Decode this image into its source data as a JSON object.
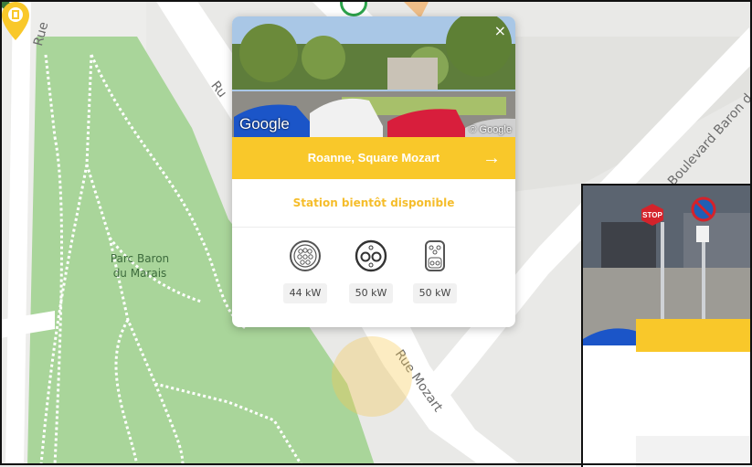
{
  "map": {
    "roads": {
      "rue_left": "Rue",
      "rue_center_top": "Ru",
      "boulevard": "Boulevard Baron d",
      "rue_mozart": "Rue Mozart"
    },
    "park": {
      "line1": "Parc Baron",
      "line2": "du Marais"
    },
    "colors": {
      "park": "#a9d59a",
      "road": "#ffffff",
      "background": "#e9e9e7",
      "path": "#ffffff"
    }
  },
  "popup": {
    "close_label": "×",
    "photo_brand": "Google",
    "photo_copyright": "© Google",
    "station_name": "Roanne, Square Mozart",
    "station_arrow": "→",
    "status": "Station bientôt disponible",
    "connectors": [
      {
        "icon": "type2-plug-icon",
        "power": "44 kW"
      },
      {
        "icon": "chademo-plug-icon",
        "power": "50 kW"
      },
      {
        "icon": "ccs-plug-icon",
        "power": "50 kW"
      }
    ],
    "colors": {
      "accent": "#f9c82a",
      "status_text": "#f5bd2b"
    }
  },
  "streetview_panel": {
    "sign_stop": "STOP"
  }
}
